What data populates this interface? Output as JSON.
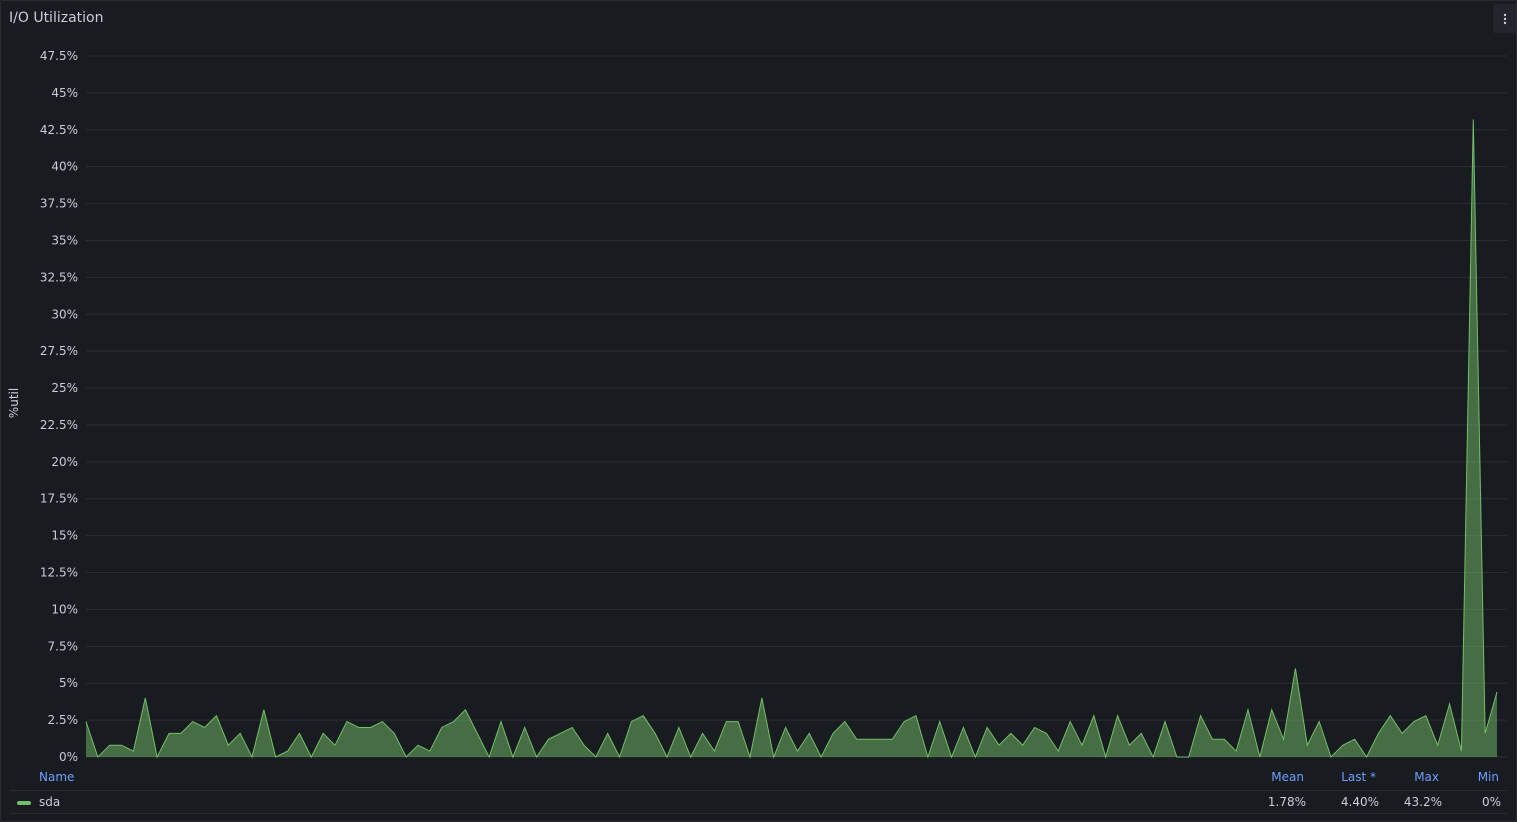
{
  "panel": {
    "title": "I/O Utilization",
    "menu_icon": "kebab-menu-icon"
  },
  "chart_data": {
    "type": "area",
    "ylabel": "%util",
    "ylim": [
      0,
      47.5
    ],
    "yticks": [
      "0%",
      "2.5%",
      "5%",
      "7.5%",
      "10%",
      "12.5%",
      "15%",
      "17.5%",
      "20%",
      "22.5%",
      "25%",
      "27.5%",
      "30%",
      "32.5%",
      "35%",
      "37.5%",
      "40%",
      "42.5%",
      "45%",
      "47.5%"
    ],
    "grid": true,
    "series": [
      {
        "name": "sda",
        "color": "#73bf69",
        "values": [
          2.4,
          0,
          0.8,
          0.8,
          0.4,
          4.0,
          0,
          1.6,
          1.6,
          2.4,
          2.0,
          2.8,
          0.8,
          1.6,
          0,
          3.2,
          0,
          0.4,
          1.6,
          0,
          1.6,
          0.8,
          2.4,
          2.0,
          2.0,
          2.4,
          1.6,
          0,
          0.8,
          0.4,
          2.0,
          2.4,
          3.2,
          1.6,
          0,
          2.4,
          0,
          2.0,
          0,
          1.2,
          1.6,
          2.0,
          0.8,
          0,
          1.6,
          0,
          2.4,
          2.8,
          1.6,
          0,
          2.0,
          0,
          1.6,
          0.4,
          2.4,
          2.4,
          0,
          4.0,
          0,
          2.0,
          0.4,
          1.6,
          0,
          1.6,
          2.4,
          1.2,
          1.2,
          1.2,
          1.2,
          2.4,
          2.8,
          0,
          2.4,
          0,
          2.0,
          0,
          2.0,
          0.8,
          1.6,
          0.8,
          2.0,
          1.6,
          0.4,
          2.4,
          0.8,
          2.8,
          0,
          2.8,
          0.8,
          1.6,
          0,
          2.4,
          0,
          0,
          2.8,
          1.2,
          1.2,
          0.4,
          3.2,
          0,
          3.2,
          1.2,
          6.0,
          0.8,
          2.4,
          0,
          0.8,
          1.2,
          0,
          1.6,
          2.8,
          1.6,
          2.4,
          2.8,
          0.8,
          3.6,
          0.4,
          43.2,
          1.6,
          4.4
        ]
      }
    ]
  },
  "legend": {
    "columns": {
      "name": "Name",
      "mean": "Mean",
      "last": "Last *",
      "max": "Max",
      "min": "Min"
    },
    "rows": [
      {
        "name": "sda",
        "color": "#73bf69",
        "mean": "1.78%",
        "last": "4.40%",
        "max": "43.2%",
        "min": "0%"
      }
    ]
  }
}
